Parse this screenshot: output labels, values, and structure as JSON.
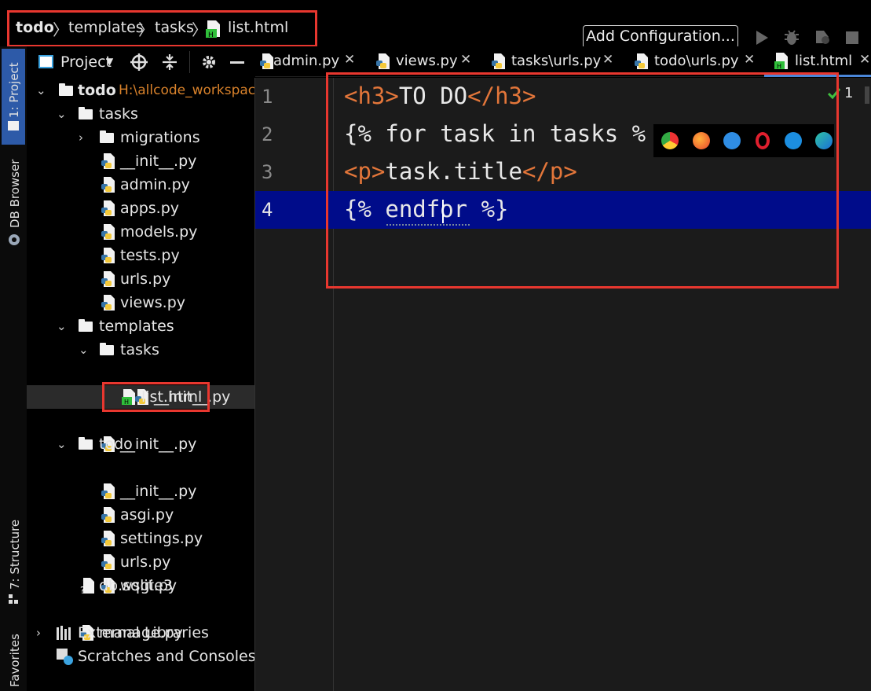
{
  "breadcrumb": {
    "root": "todo",
    "items": [
      "templates",
      "tasks"
    ],
    "file": "list.html"
  },
  "toolbar": {
    "add_configuration": "Add Configuration..."
  },
  "tool_windows": {
    "project": "1: Project",
    "db_browser": "DB Browser",
    "structure": "7: Structure",
    "favorites": "Favorites"
  },
  "project_panel": {
    "title": "Project"
  },
  "tree": [
    {
      "label": "todo",
      "path": "H:\\allcode_workspac",
      "type": "folder-bold"
    },
    {
      "label": "tasks",
      "type": "folder"
    },
    {
      "label": "migrations",
      "type": "folder"
    },
    {
      "label": "__init__.py",
      "type": "py"
    },
    {
      "label": "admin.py",
      "type": "py"
    },
    {
      "label": "apps.py",
      "type": "py"
    },
    {
      "label": "models.py",
      "type": "py"
    },
    {
      "label": "tests.py",
      "type": "py"
    },
    {
      "label": "urls.py",
      "type": "py"
    },
    {
      "label": "views.py",
      "type": "py"
    },
    {
      "label": "templates",
      "type": "folder"
    },
    {
      "label": "tasks",
      "type": "folder"
    },
    {
      "label": "__init__.py",
      "type": "py"
    },
    {
      "label": "list.html",
      "type": "html",
      "selected": true
    },
    {
      "label": "__init__.py",
      "type": "py"
    },
    {
      "label": "todo",
      "type": "folder"
    },
    {
      "label": "__init__.py",
      "type": "py"
    },
    {
      "label": "asgi.py",
      "type": "py"
    },
    {
      "label": "settings.py",
      "type": "py"
    },
    {
      "label": "urls.py",
      "type": "py"
    },
    {
      "label": "wsgi.py",
      "type": "py"
    },
    {
      "label": "db.sqlite3",
      "type": "file"
    },
    {
      "label": "manage.py",
      "type": "py"
    },
    {
      "label": "External Libraries",
      "type": "lib"
    },
    {
      "label": "Scratches and Consoles",
      "type": "scratch"
    }
  ],
  "tabs": [
    "admin.py",
    "views.py",
    "tasks\\urls.py",
    "todo\\urls.py",
    "list.html"
  ],
  "editor": {
    "line_numbers": [
      "1",
      "2",
      "3",
      "4"
    ],
    "lines": {
      "l1_open": "<h3>",
      "l1_text": "TO DO",
      "l1_close": "</h3>",
      "l2": "{% for task in tasks %",
      "l3_open": "<p>",
      "l3_text": "task.title",
      "l3_close": "</p>",
      "l4": "{% endfor %}"
    },
    "inspection_count": "1",
    "active_line": 4
  },
  "colors": {
    "accent_red": "#e8372f",
    "current_line": "#000c8a",
    "tag": "#e3763a",
    "project_tab": "#2d5aa8"
  }
}
